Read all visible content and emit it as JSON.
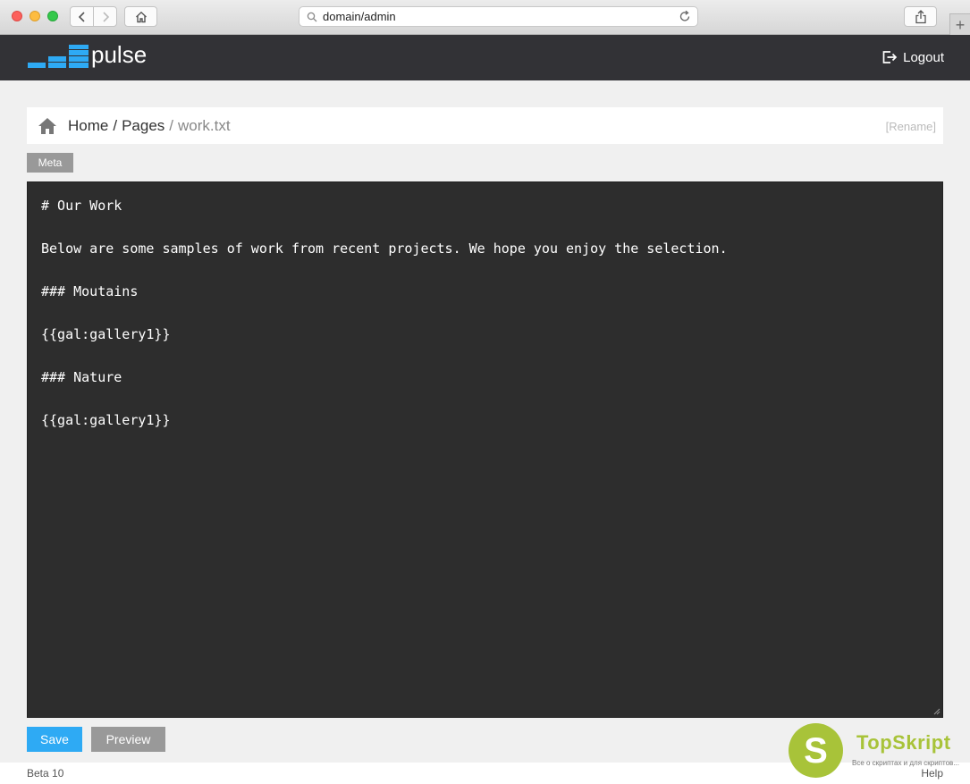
{
  "browser": {
    "url": "domain/admin"
  },
  "header": {
    "logo_text": "pulse",
    "logout_label": "Logout",
    "accent_color": "#2eaaf4"
  },
  "breadcrumb": {
    "home": "Home",
    "separator": "/",
    "pages": "Pages",
    "current": "work.txt",
    "rename": "[Rename]"
  },
  "meta_button": "Meta",
  "editor": {
    "lines": [
      "# Our Work",
      "",
      "Below are some samples of work from recent projects. We hope you enjoy the selection.",
      "",
      "### Moutains",
      "",
      "{{gal:gallery1}}",
      "",
      "### Nature",
      "",
      "{{gal:gallery1}}"
    ]
  },
  "actions": {
    "save": "Save",
    "preview": "Preview"
  },
  "footer": {
    "version": "Beta 10",
    "help": "Help"
  },
  "watermark": {
    "name": "TopSkript",
    "tagline": "Все о скриптах и для скриптов...",
    "letter": "S"
  }
}
